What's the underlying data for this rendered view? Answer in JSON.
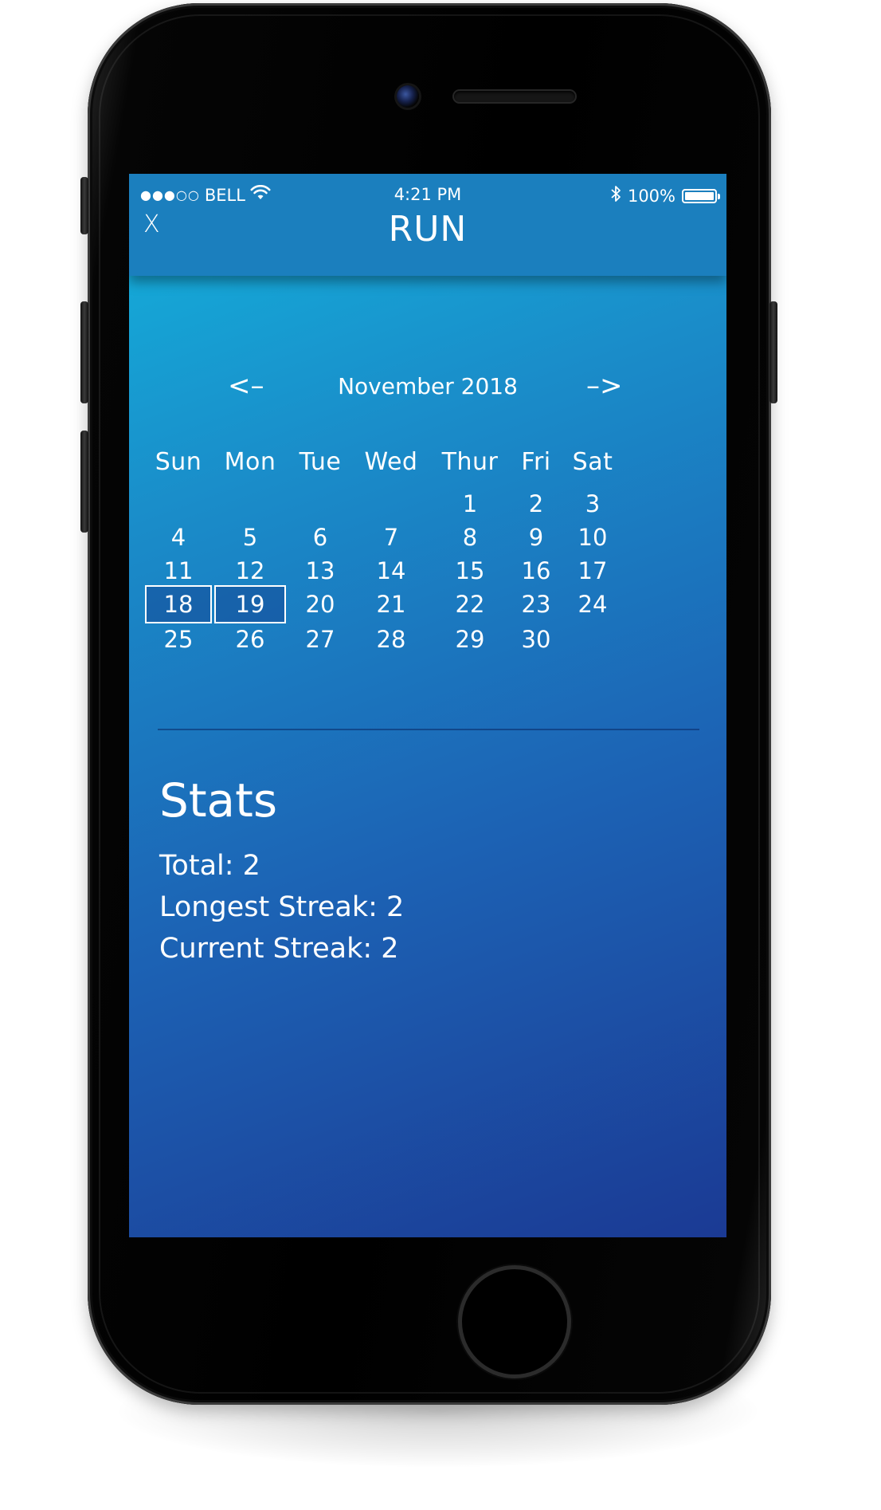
{
  "status_bar": {
    "signal": "●●●○○",
    "carrier": "BELL",
    "wifi_icon": "wifi-icon",
    "time": "4:21 PM",
    "bluetooth_icon": "bluetooth-icon",
    "battery": "100%",
    "battery_level": 1.0
  },
  "header": {
    "close_label": "X",
    "title": "RUN"
  },
  "calendar": {
    "prev_label": "<–",
    "next_label": "–>",
    "month_label": "November 2018",
    "weekdays": [
      "Sun",
      "Mon",
      "Tue",
      "Wed",
      "Thur",
      "Fri",
      "Sat"
    ],
    "weeks": [
      [
        "",
        "",
        "",
        "",
        "1",
        "2",
        "3"
      ],
      [
        "4",
        "5",
        "6",
        "7",
        "8",
        "9",
        "10"
      ],
      [
        "11",
        "12",
        "13",
        "14",
        "15",
        "16",
        "17"
      ],
      [
        "18",
        "19",
        "20",
        "21",
        "22",
        "23",
        "24"
      ],
      [
        "25",
        "26",
        "27",
        "28",
        "29",
        "30",
        ""
      ]
    ],
    "marked_days": [
      "18",
      "19"
    ]
  },
  "stats": {
    "title": "Stats",
    "total": "Total: 2",
    "longest_streak": "Longest Streak: 2",
    "current_streak": "Current Streak: 2"
  },
  "colors": {
    "gradient_start": "#13b2dc",
    "gradient_end": "#1b3a94",
    "navbar": "#1b7fbe",
    "text": "#ffffff"
  }
}
